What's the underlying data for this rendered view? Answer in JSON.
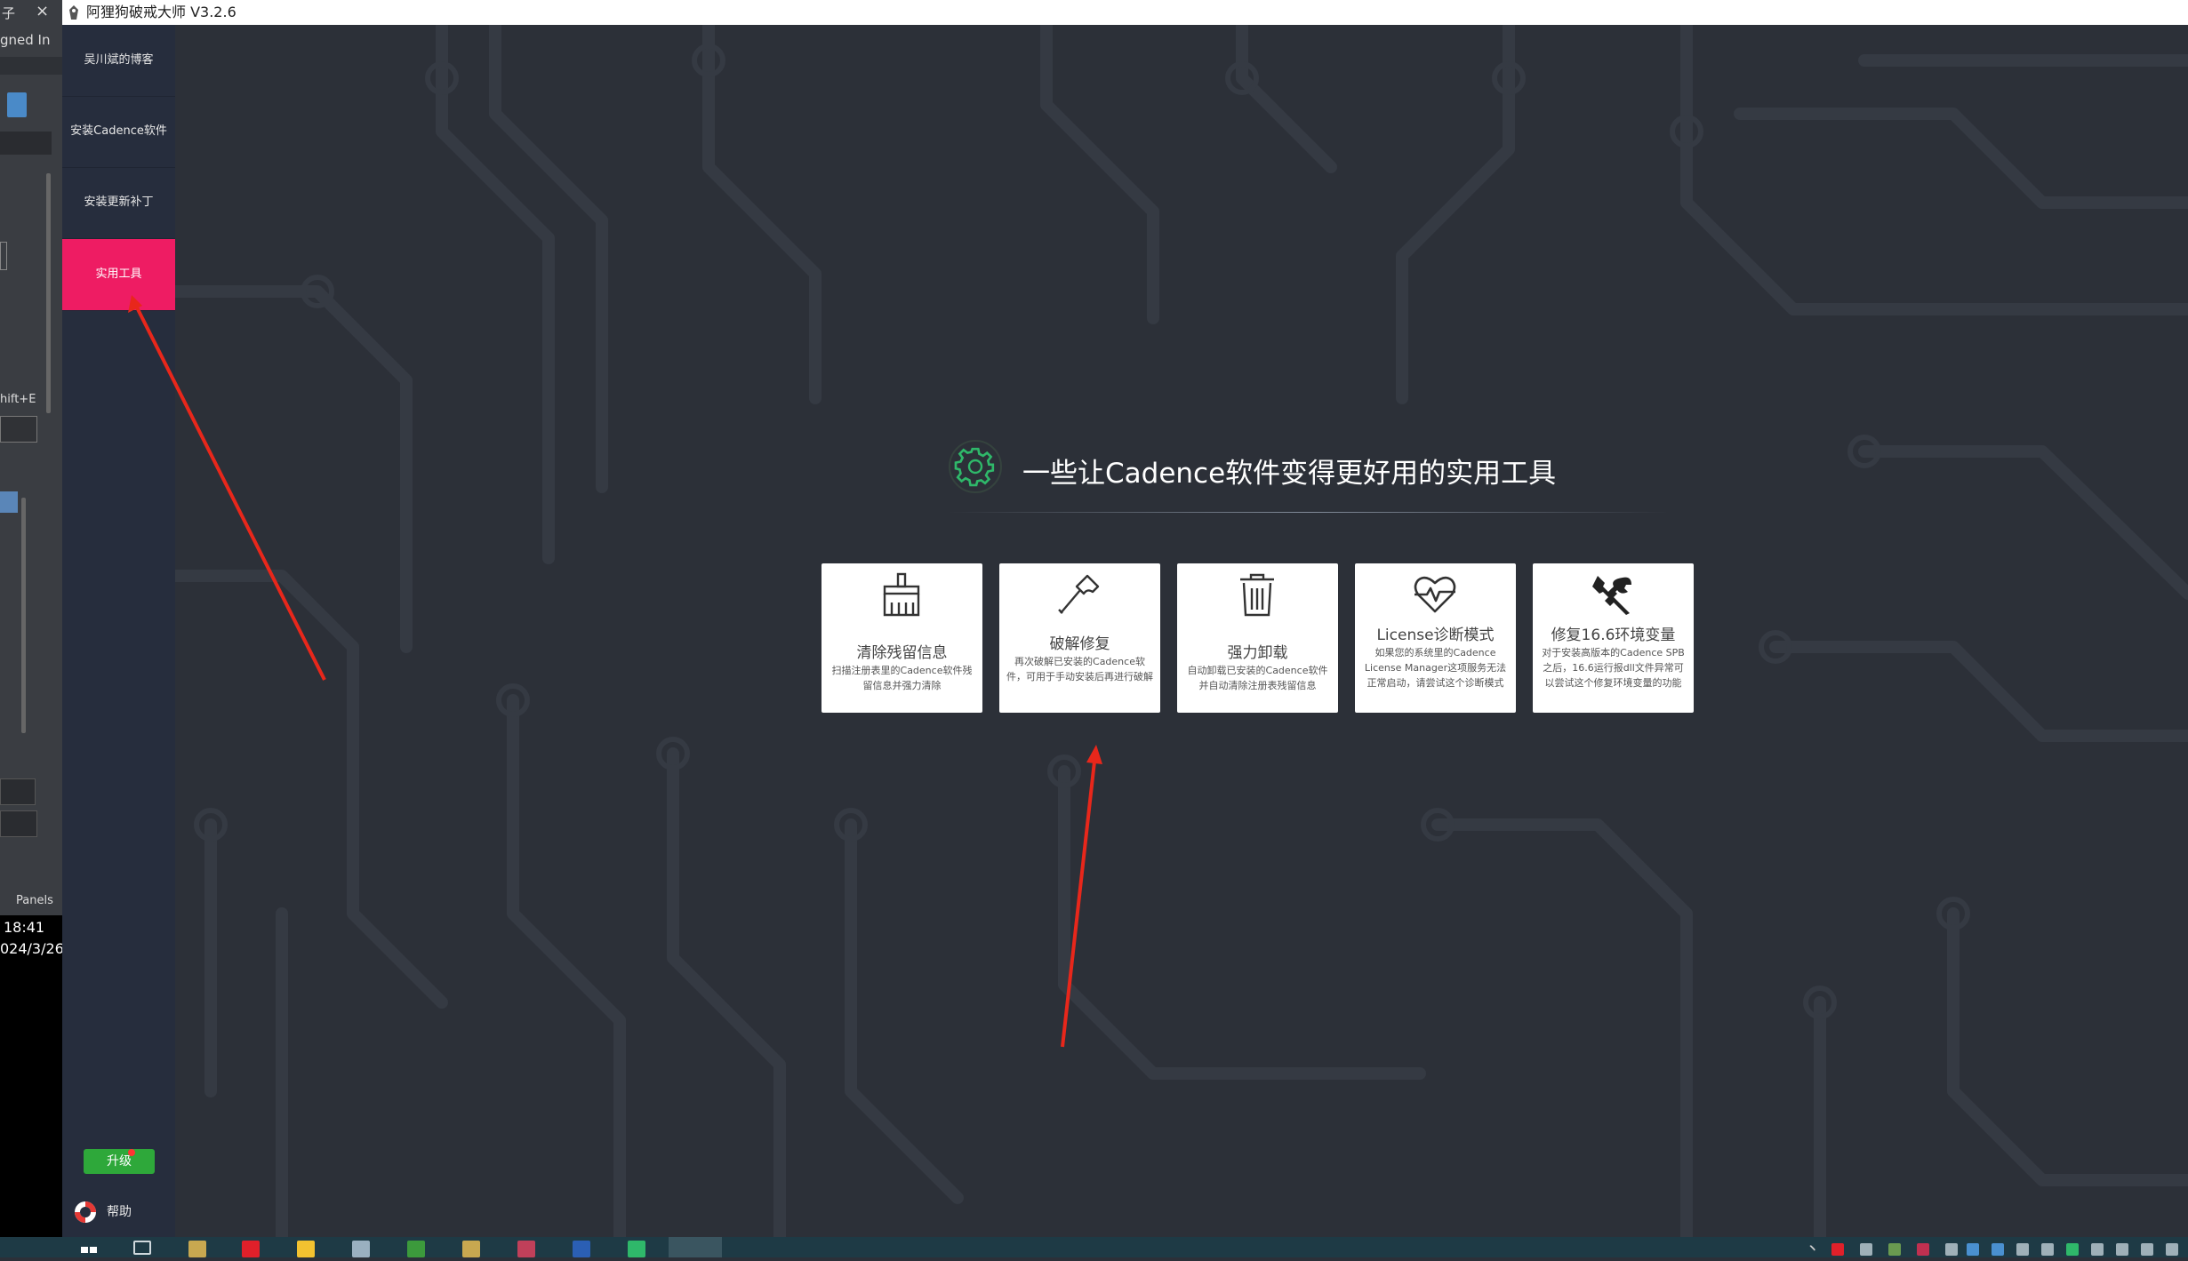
{
  "window": {
    "title": "阿狸狗破戒大师 V3.2.6"
  },
  "background_window": {
    "fragments": [
      {
        "id": "f1",
        "text": "子"
      },
      {
        "id": "f2",
        "text": "×"
      },
      {
        "id": "f3",
        "text": "gned In"
      },
      {
        "id": "f4",
        "text": "▾"
      },
      {
        "id": "f5",
        "text": "hift+E"
      },
      {
        "id": "f6",
        "text": "Panels"
      },
      {
        "id": "f7",
        "text": "18:41"
      },
      {
        "id": "f8",
        "text": "024/3/26"
      }
    ]
  },
  "sidebar": {
    "items": [
      {
        "label": "吴川斌的博客"
      },
      {
        "label": "安装Cadence软件"
      },
      {
        "label": "安装更新补丁"
      },
      {
        "label": "实用工具",
        "active": true
      }
    ],
    "upgrade_label": "升级",
    "help_label": "帮助"
  },
  "main": {
    "heading": "一些让Cadence软件变得更好用的实用工具",
    "cards": [
      {
        "icon": "broom-icon",
        "title": "清除残留信息",
        "desc": "扫描注册表里的Cadence软件残留信息并强力清除"
      },
      {
        "icon": "axe-icon",
        "title": "破解修复",
        "desc": "再次破解已安装的Cadence软件，可用于手动安装后再进行破解"
      },
      {
        "icon": "trash-icon",
        "title": "强力卸载",
        "desc": "自动卸载已安装的Cadence软件并自动清除注册表残留信息"
      },
      {
        "icon": "heartbeat-icon",
        "title": "License诊断模式",
        "desc": "如果您的系统里的Cadence License Manager这项服务无法正常启动，请尝试这个诊断模式"
      },
      {
        "icon": "wrench-icon",
        "title": "修复16.6环境变量",
        "desc": "对于安装高版本的Cadence SPB之后，16.6运行报dll文件异常可以尝试这个修复环境变量的功能"
      }
    ]
  },
  "colors": {
    "sidebar_bg": "#262d3d",
    "active_item": "#ee1c63",
    "main_bg": "#2c3038",
    "upgrade_green": "#2ea83a",
    "accent_green": "#2fb86a",
    "annotation_red": "#e8271b"
  }
}
